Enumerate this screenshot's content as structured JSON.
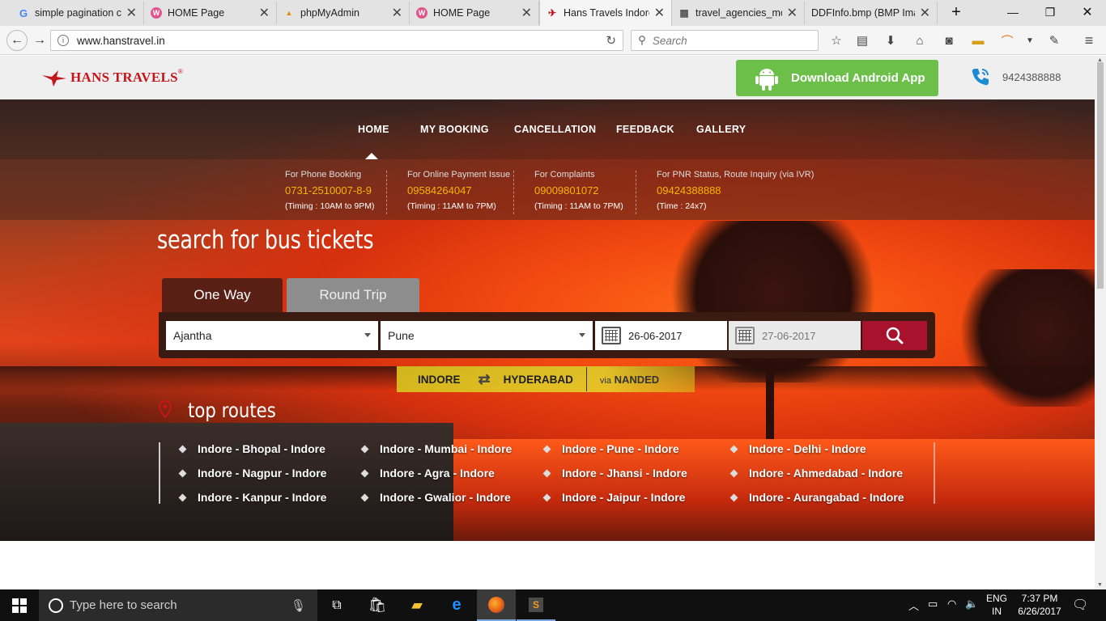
{
  "browser": {
    "tabs": [
      {
        "title": "simple pagination c",
        "icon": "google-icon",
        "active": false
      },
      {
        "title": "HOME Page",
        "icon": "site-icon",
        "active": false
      },
      {
        "title": "phpMyAdmin",
        "icon": "phpmyadmin-icon",
        "active": false
      },
      {
        "title": "HOME Page",
        "icon": "site-icon",
        "active": false
      },
      {
        "title": "Hans Travels Indore",
        "icon": "hans-icon",
        "active": true
      },
      {
        "title": "travel_agencies_mo",
        "icon": "table-icon",
        "active": false
      },
      {
        "title": "DDFInfo.bmp (BMP Ima",
        "icon": "image-icon",
        "active": false
      }
    ],
    "url": "www.hanstravel.in",
    "search_placeholder": "Search"
  },
  "header": {
    "brand": "HANS TRAVELS",
    "reg_mark": "®",
    "android_button": "Download Android App",
    "phone": "9424388888"
  },
  "nav": {
    "items": [
      "HOME",
      "MY BOOKING",
      "CANCELLATION",
      "FEEDBACK",
      "GALLERY"
    ],
    "active": "HOME"
  },
  "contacts": [
    {
      "label": "For Phone Booking",
      "number": "0731-2510007-8-9",
      "timing": "(Timing : 10AM to 9PM)"
    },
    {
      "label": "For Online Payment Issue",
      "number": "09584264047",
      "timing": "(Timing : 11AM to 7PM)"
    },
    {
      "label": "For Complaints",
      "number": "09009801072",
      "timing": "(Timing : 11AM to 7PM)"
    },
    {
      "label": "For PNR Status, Route Inquiry (via IVR)",
      "number": "09424388888",
      "timing": "(Time : 24x7)"
    }
  ],
  "search": {
    "title": "search for bus tickets",
    "tabs": {
      "one_way": "One Way",
      "round_trip": "Round Trip"
    },
    "from": "Ajantha",
    "to": "Pune",
    "depart_date": "26-06-2017",
    "return_date": "27-06-2017"
  },
  "promo": {
    "from": "INDORE",
    "to": "HYDERABAD",
    "via_label": "via",
    "via": "NANDED"
  },
  "top_routes": {
    "title": "top routes",
    "routes": [
      "Indore - Bhopal - Indore",
      "Indore - Mumbai - Indore",
      "Indore - Pune - Indore",
      "Indore - Delhi - Indore",
      "Indore - Nagpur - Indore",
      "Indore - Agra - Indore",
      "Indore - Jhansi - Indore",
      "Indore - Ahmedabad - Indore",
      "Indore - Kanpur - Indore",
      "Indore - Gwalior - Indore",
      "Indore - Jaipur - Indore",
      "Indore - Aurangabad - Indore"
    ]
  },
  "taskbar": {
    "search_placeholder": "Type here to search",
    "lang": "ENG",
    "region": "IN",
    "time": "7:37 PM",
    "date": "6/26/2017"
  },
  "colors": {
    "brand_red": "#c4161c",
    "android_green": "#6cc04a",
    "accent_orange": "#f7b500",
    "search_red": "#a8122c",
    "promo_yellow": "#d7be1e"
  }
}
